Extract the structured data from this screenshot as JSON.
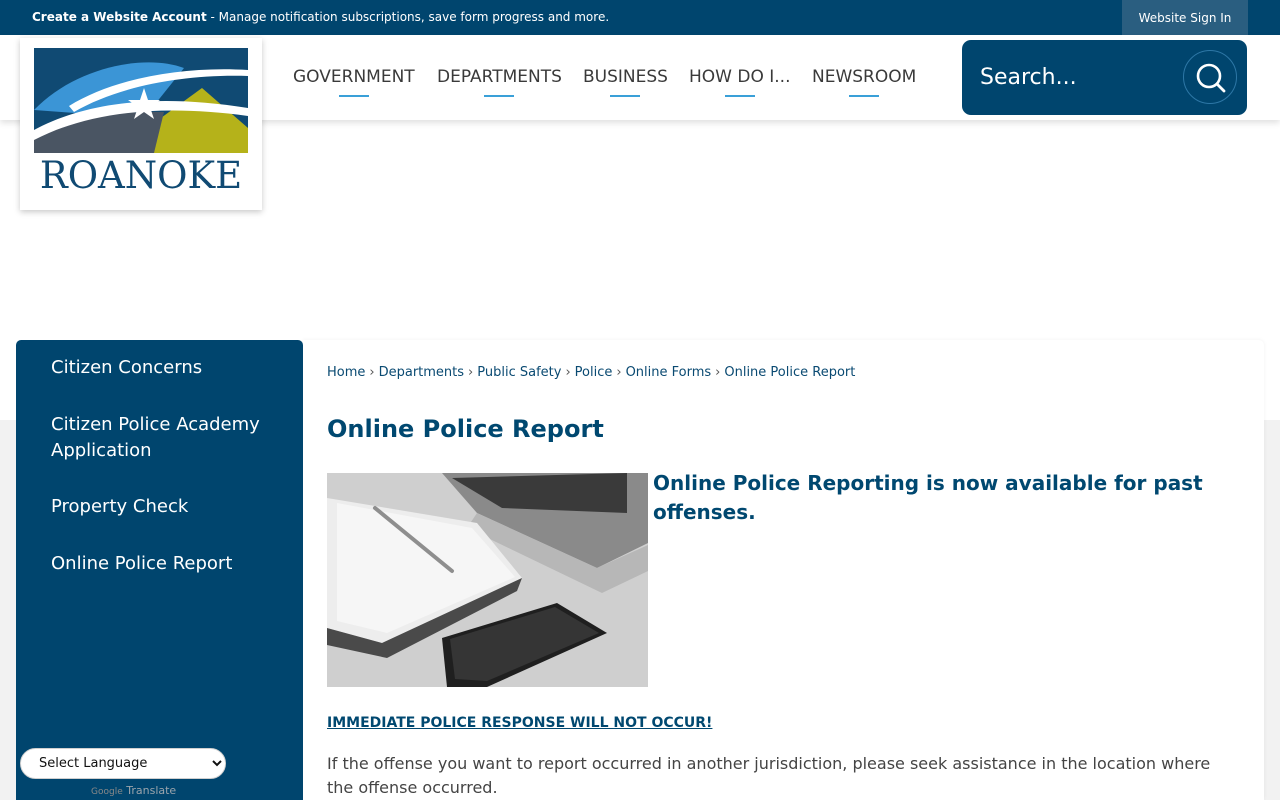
{
  "topbar": {
    "create_account": "Create a Website Account",
    "message": " - Manage notification subscriptions, save form progress and more.",
    "sign_in": "Website Sign In"
  },
  "logo": {
    "text": "ROANOKE"
  },
  "nav": [
    {
      "label": "GOVERNMENT"
    },
    {
      "label": "DEPARTMENTS"
    },
    {
      "label": "BUSINESS"
    },
    {
      "label": "HOW DO I..."
    },
    {
      "label": "NEWSROOM"
    }
  ],
  "search": {
    "placeholder": "Search..."
  },
  "sidebar": {
    "items": [
      {
        "label": "Citizen Concerns"
      },
      {
        "label": "Citizen Police Academy Application"
      },
      {
        "label": "Property Check"
      },
      {
        "label": "Online Police Report"
      }
    ]
  },
  "language": {
    "select": "Select Language",
    "google": "Google",
    "translate": "Translate"
  },
  "breadcrumb": {
    "items": [
      {
        "label": "Home"
      },
      {
        "label": "Departments"
      },
      {
        "label": "Public Safety"
      },
      {
        "label": "Police"
      },
      {
        "label": "Online Forms"
      },
      {
        "label": "Online Police Report"
      }
    ],
    "separator": "›"
  },
  "main": {
    "title": "Online Police Report",
    "lead": "Online Police Reporting is now available for past offenses.",
    "warning": "IMMEDIATE POLICE RESPONSE WILL NOT OCCUR!",
    "paragraph": "If the offense you want to report occurred in another jurisdiction, please seek assistance in the location where the offense occurred."
  },
  "colors": {
    "primary": "#00456e",
    "accent": "#3aa0d8",
    "logo_blue": "#3b95d6",
    "logo_olive": "#b5b21a",
    "logo_gray": "#4a5563"
  }
}
